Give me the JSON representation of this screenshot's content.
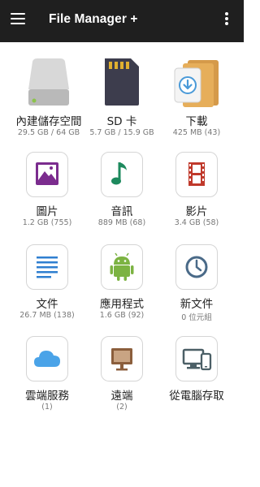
{
  "app": {
    "title": "File Manager +"
  },
  "storage": [
    {
      "label": "內建儲存空間",
      "sub": "29.5 GB / 64 GB"
    },
    {
      "label": "SD 卡",
      "sub": "5.7 GB / 15.9 GB"
    },
    {
      "label": "下載",
      "sub": "425 MB (43)"
    }
  ],
  "categories": [
    {
      "label": "圖片",
      "sub": "1.2 GB (755)"
    },
    {
      "label": "音訊",
      "sub": "889 MB (68)"
    },
    {
      "label": "影片",
      "sub": "3.4 GB (58)"
    },
    {
      "label": "文件",
      "sub": "26.7 MB (138)"
    },
    {
      "label": "應用程式",
      "sub": "1.6 GB (92)"
    },
    {
      "label": "新文件",
      "sub": "0 位元組"
    },
    {
      "label": "雲端服務",
      "sub": "(1)"
    },
    {
      "label": "遠端",
      "sub": "(2)"
    },
    {
      "label": "從電腦存取",
      "sub": ""
    }
  ],
  "colors": {
    "appbar": "#1f1f1f",
    "image": "#7b2c8e",
    "audio": "#1e8a5e",
    "video": "#c0392b",
    "document": "#2f7fd0",
    "app": "#7cb342",
    "recent": "#4a6a88",
    "cloud": "#4aa3e8",
    "remote": "#8b5e3c",
    "pc": "#4b5f66"
  }
}
